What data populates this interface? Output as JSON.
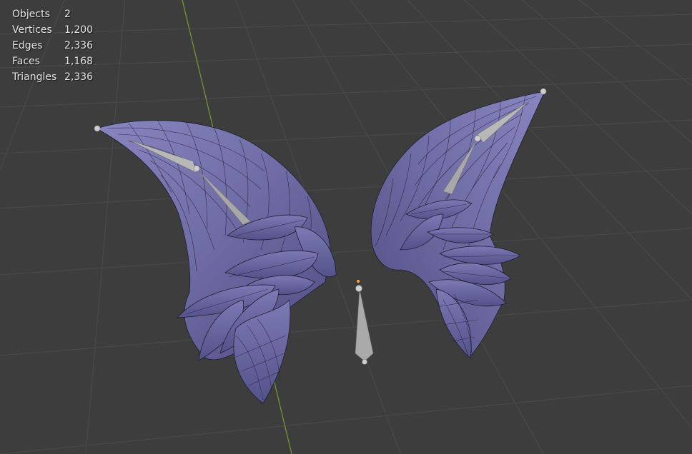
{
  "stats": {
    "rows": [
      {
        "label": "Objects",
        "value": "2"
      },
      {
        "label": "Vertices",
        "value": "1,200"
      },
      {
        "label": "Edges",
        "value": "2,336"
      },
      {
        "label": "Faces",
        "value": "1,168"
      },
      {
        "label": "Triangles",
        "value": "2,336"
      }
    ]
  },
  "scene": {
    "background_color": "#3d3d3d",
    "grid_color": "#4a4a4a",
    "y_axis_color": "#7d9c2c",
    "mesh_fill_color": "#6c6aa0",
    "mesh_wire_color": "#1c1c2c",
    "bone_color": "#b8b8b8",
    "origin_color": "#ffa020"
  }
}
